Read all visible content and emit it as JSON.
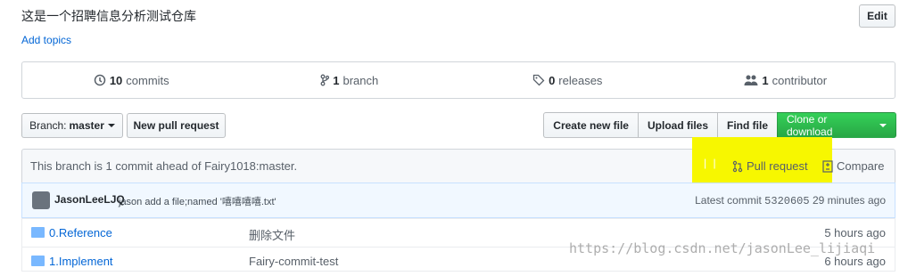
{
  "repo": {
    "description": "这是一个招聘信息分析测试仓库",
    "add_topics": "Add topics",
    "edit_label": "Edit"
  },
  "summary": {
    "commits_num": "10",
    "commits_label": "commits",
    "branches_num": "1",
    "branches_label": "branch",
    "releases_num": "0",
    "releases_label": "releases",
    "contributors_num": "1",
    "contributors_label": "contributor"
  },
  "toolbar": {
    "branch_prefix": "Branch:",
    "branch_name": "master",
    "new_pull_request": "New pull request",
    "create_new_file": "Create new file",
    "upload_files": "Upload files",
    "find_file": "Find file",
    "clone_or_download": "Clone or download"
  },
  "branch_status": {
    "text": "This branch is 1 commit ahead of Fairy1018:master.",
    "pull_request": "Pull request",
    "compare": "Compare"
  },
  "latest_commit": {
    "author": "JasonLeeLJQ",
    "message": "jason add a file;named '嘻嘻嘻嘻.txt'",
    "prefix": "Latest commit",
    "sha": "5320605",
    "age": "29 minutes ago"
  },
  "files": [
    {
      "name": "0.Reference",
      "message": "删除文件",
      "age": "5 hours ago"
    },
    {
      "name": "1.Implement",
      "message": "Fairy-commit-test",
      "age": "6 hours ago"
    }
  ],
  "watermark": "https://blog.csdn.net/jasonLee_lijiaqi",
  "colors": {
    "accent": "#0366d6",
    "clone_green": "#28a745",
    "highlight": "#f7f700"
  }
}
